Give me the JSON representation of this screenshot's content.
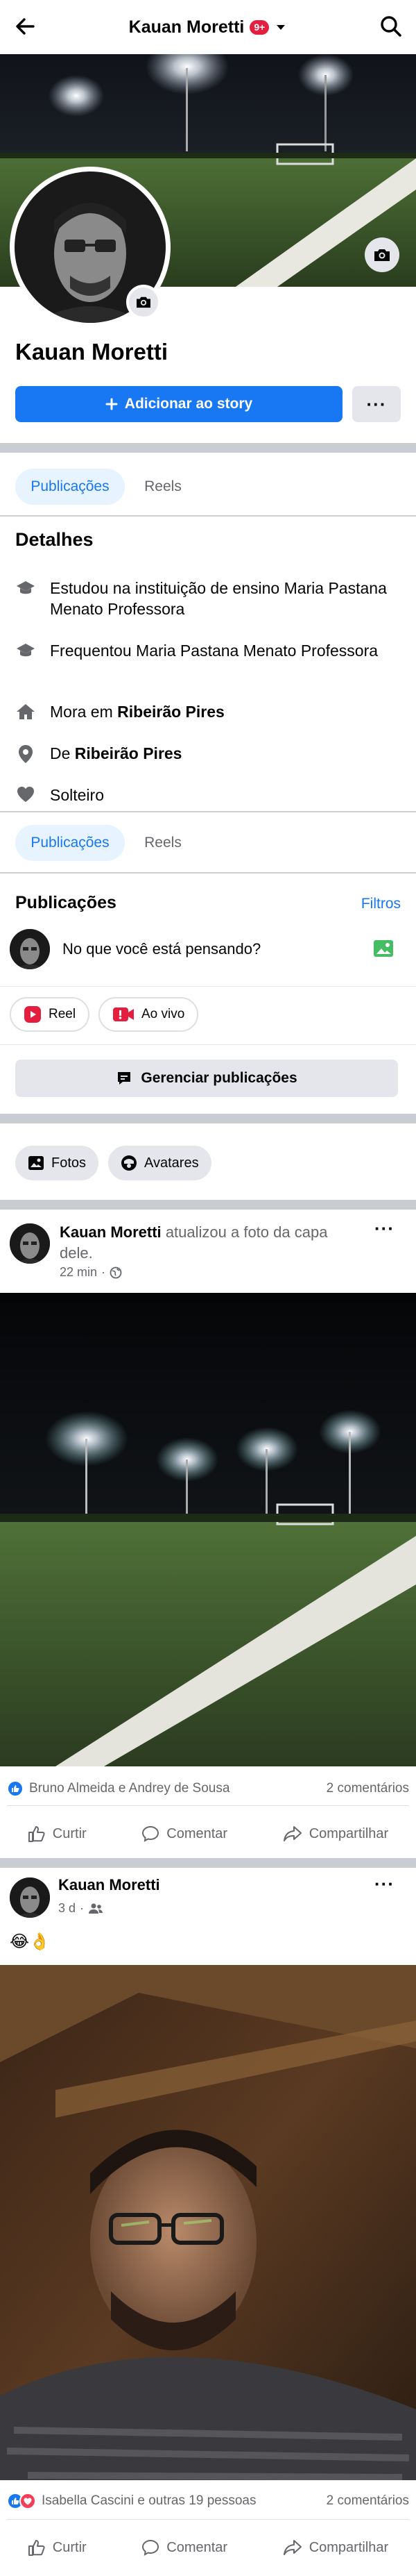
{
  "header": {
    "title": "Kauan Moretti",
    "notif_badge": "9+",
    "icons": [
      "back-arrow-icon",
      "chevron-down-icon",
      "search-icon"
    ]
  },
  "profile": {
    "name": "Kauan Moretti",
    "story_button": "Adicionar ao story",
    "more_button": "···"
  },
  "tabs_top": {
    "items": [
      "Publicações",
      "Reels"
    ],
    "active": "Publicações"
  },
  "details": {
    "title": "Detalhes",
    "items": [
      {
        "icon": "education-icon",
        "text": "Estudou na instituição de ensino Maria Pastana Menato Professora"
      },
      {
        "icon": "education-icon",
        "text": "Frequentou Maria Pastana Menato Professora"
      },
      {
        "icon": "home-icon",
        "prefix": "Mora em ",
        "bold": "Ribeirão Pires"
      },
      {
        "icon": "location-pin-icon",
        "prefix": "De ",
        "bold": "Ribeirão Pires"
      },
      {
        "icon": "heart-icon",
        "text": "Solteiro"
      }
    ]
  },
  "tabs_bottom": {
    "items": [
      "Publicações",
      "Reels"
    ],
    "active": "Publicações"
  },
  "posts_section": {
    "title": "Publicações",
    "filter": "Filtros",
    "composer_placeholder": "No que você está pensando?",
    "reel_chip": "Reel",
    "live_chip": "Ao vivo",
    "manage_button": "Gerenciar publicações",
    "photos_chip": "Fotos",
    "avatars_chip": "Avatares"
  },
  "posts": [
    {
      "author": "Kauan Moretti",
      "action": "atualizou a foto da capa dele.",
      "time": "22 min",
      "audience_icon": "globe-icon",
      "reactions_text": "Bruno Almeida e Andrey de Sousa",
      "comments": "2 comentários"
    },
    {
      "author": "Kauan Moretti",
      "action": "",
      "time": "3 d",
      "audience_icon": "friends-icon",
      "body": "😂👌",
      "reactions_text": "Isabella Cascini e outras 19 pessoas",
      "comments": "2 comentários"
    }
  ],
  "actions": {
    "like": "Curtir",
    "comment": "Comentar",
    "share": "Compartilhar"
  },
  "colors": {
    "accent": "#1877f2",
    "badge": "#e41e3f",
    "separator": "#c9ccd1",
    "reel": "#e41e3f"
  }
}
